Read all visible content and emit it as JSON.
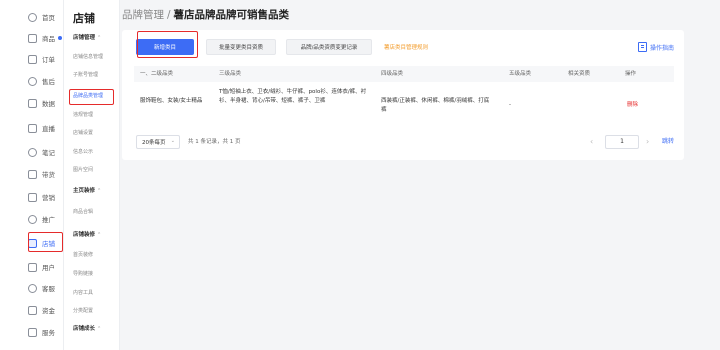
{
  "rail": {
    "items": [
      {
        "label": "首页",
        "icon": "home-icon"
      },
      {
        "label": "商品",
        "icon": "product-icon",
        "dot": true
      },
      {
        "label": "订单",
        "icon": "order-icon"
      },
      {
        "label": "售后",
        "icon": "after-sale-icon"
      },
      {
        "label": "数据",
        "icon": "data-icon"
      },
      {
        "label": "直播",
        "icon": "live-icon"
      },
      {
        "label": "笔记",
        "icon": "note-icon"
      },
      {
        "label": "带货",
        "icon": "promote-icon"
      },
      {
        "label": "营销",
        "icon": "marketing-icon"
      },
      {
        "label": "推广",
        "icon": "ads-icon"
      },
      {
        "label": "店铺",
        "icon": "store-icon",
        "active": true
      },
      {
        "label": "用户",
        "icon": "user-icon"
      },
      {
        "label": "客服",
        "icon": "service-icon"
      },
      {
        "label": "资金",
        "icon": "funds-icon"
      },
      {
        "label": "服务",
        "icon": "shield-icon"
      }
    ]
  },
  "submenu": {
    "title": "店铺",
    "groups": [
      {
        "label": "店铺管理",
        "items": [
          "店铺信息管理",
          "子账号管理",
          "品牌品类管理",
          "违规管理",
          "店铺设置",
          "信息公示",
          "图片空间"
        ]
      },
      {
        "label": "主页装修",
        "items": [
          "商品合辑"
        ]
      },
      {
        "label": "店铺装修",
        "items": [
          "首页装修",
          "导购链接",
          "内容工具",
          "分类配置"
        ]
      },
      {
        "label": "店铺成长",
        "items": []
      }
    ],
    "active_item": "品牌品类管理"
  },
  "breadcrumb": {
    "parent": "品牌管理",
    "separator": "/",
    "current": "薯店品牌品牌可销售品类"
  },
  "toolbar": {
    "add_label": "新增类目",
    "batch_label": "批量变更类目资质",
    "records_label": "品牌/品类资质变更记录",
    "rules_label": "薯店类目管理规则",
    "guide_label": "操作指南"
  },
  "table": {
    "headers": [
      "一、二级品类",
      "三级品类",
      "四级品类",
      "五级品类",
      "相关资质",
      "操作"
    ],
    "rows": [
      {
        "level12": "服饰鞋包、女装/女士精品",
        "level3": "T恤/短袖上衣、卫衣/绒衫、牛仔裤、polo衫、连体衣/裤、衬衫、半身裙、背心/吊带、短裤、裤子、卫裤",
        "level4": "西装裤/正装裤、休闲裤、棉裤/羽绒裤、打底裤",
        "level5": "-",
        "qualification": "",
        "action": "删除"
      }
    ]
  },
  "pagination": {
    "page_size": "20条每页",
    "total": "共 1 条记录，共 1 页",
    "prev": "‹",
    "current_page": "1",
    "next": "›",
    "jump": "跳转"
  }
}
